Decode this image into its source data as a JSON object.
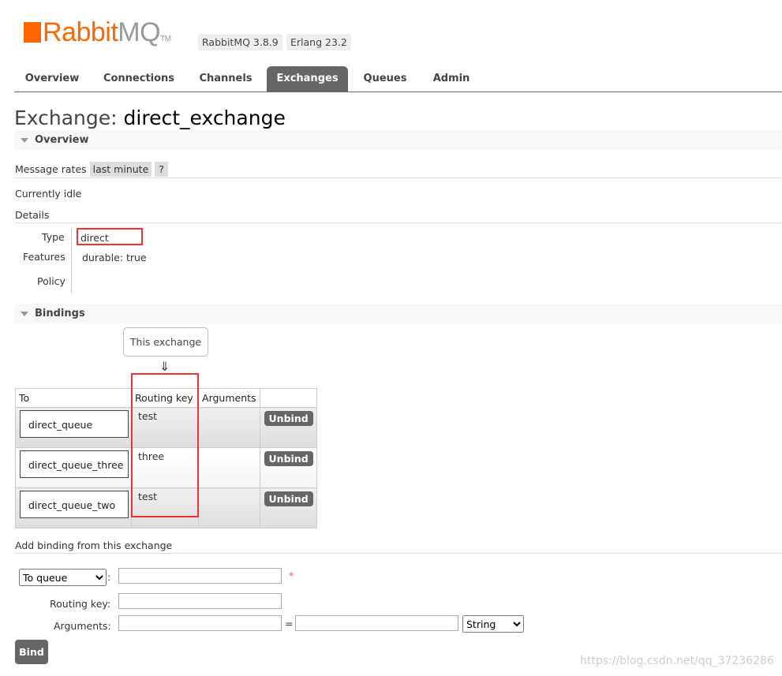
{
  "header": {
    "logo_brand": "RabbitMQ",
    "logo_text_a": "Rabbit",
    "logo_text_b": "MQ",
    "logo_tm": "TM",
    "version": "RabbitMQ 3.8.9",
    "erlang": "Erlang 23.2"
  },
  "nav": {
    "tabs": [
      "Overview",
      "Connections",
      "Channels",
      "Exchanges",
      "Queues",
      "Admin"
    ],
    "active": "Exchanges"
  },
  "page": {
    "title_prefix": "Exchange:",
    "title_name": "direct_exchange"
  },
  "overview": {
    "section": "Overview",
    "rates_label": "Message rates",
    "rates_value": "last minute",
    "help": "?",
    "status": "Currently idle",
    "details": "Details",
    "type_label": "Type",
    "type_value": "direct",
    "features_label": "Features",
    "durable_label": "durable:",
    "durable_value": "true",
    "policy_label": "Policy"
  },
  "bindings": {
    "section": "Bindings",
    "this_exchange": "This exchange",
    "arrow": "⇓",
    "headers": [
      "To",
      "Routing key",
      "Arguments",
      ""
    ],
    "rows": [
      {
        "to": "direct_queue",
        "key": "test",
        "args": "",
        "action": "Unbind"
      },
      {
        "to": "direct_queue_three",
        "key": "three",
        "args": "",
        "action": "Unbind"
      },
      {
        "to": "direct_queue_two",
        "key": "test",
        "args": "",
        "action": "Unbind"
      }
    ]
  },
  "add": {
    "title": "Add binding from this exchange",
    "dest_select": "To queue",
    "required": "*",
    "routing_label": "Routing key:",
    "args_label": "Arguments:",
    "eq": "=",
    "type_select": "String",
    "bind": "Bind"
  },
  "watermark": "https://blog.csdn.net/qq_37236286",
  "colors": {
    "brand": "#ff6600",
    "highlight": "#ee3333",
    "tab_active": "#666666"
  }
}
